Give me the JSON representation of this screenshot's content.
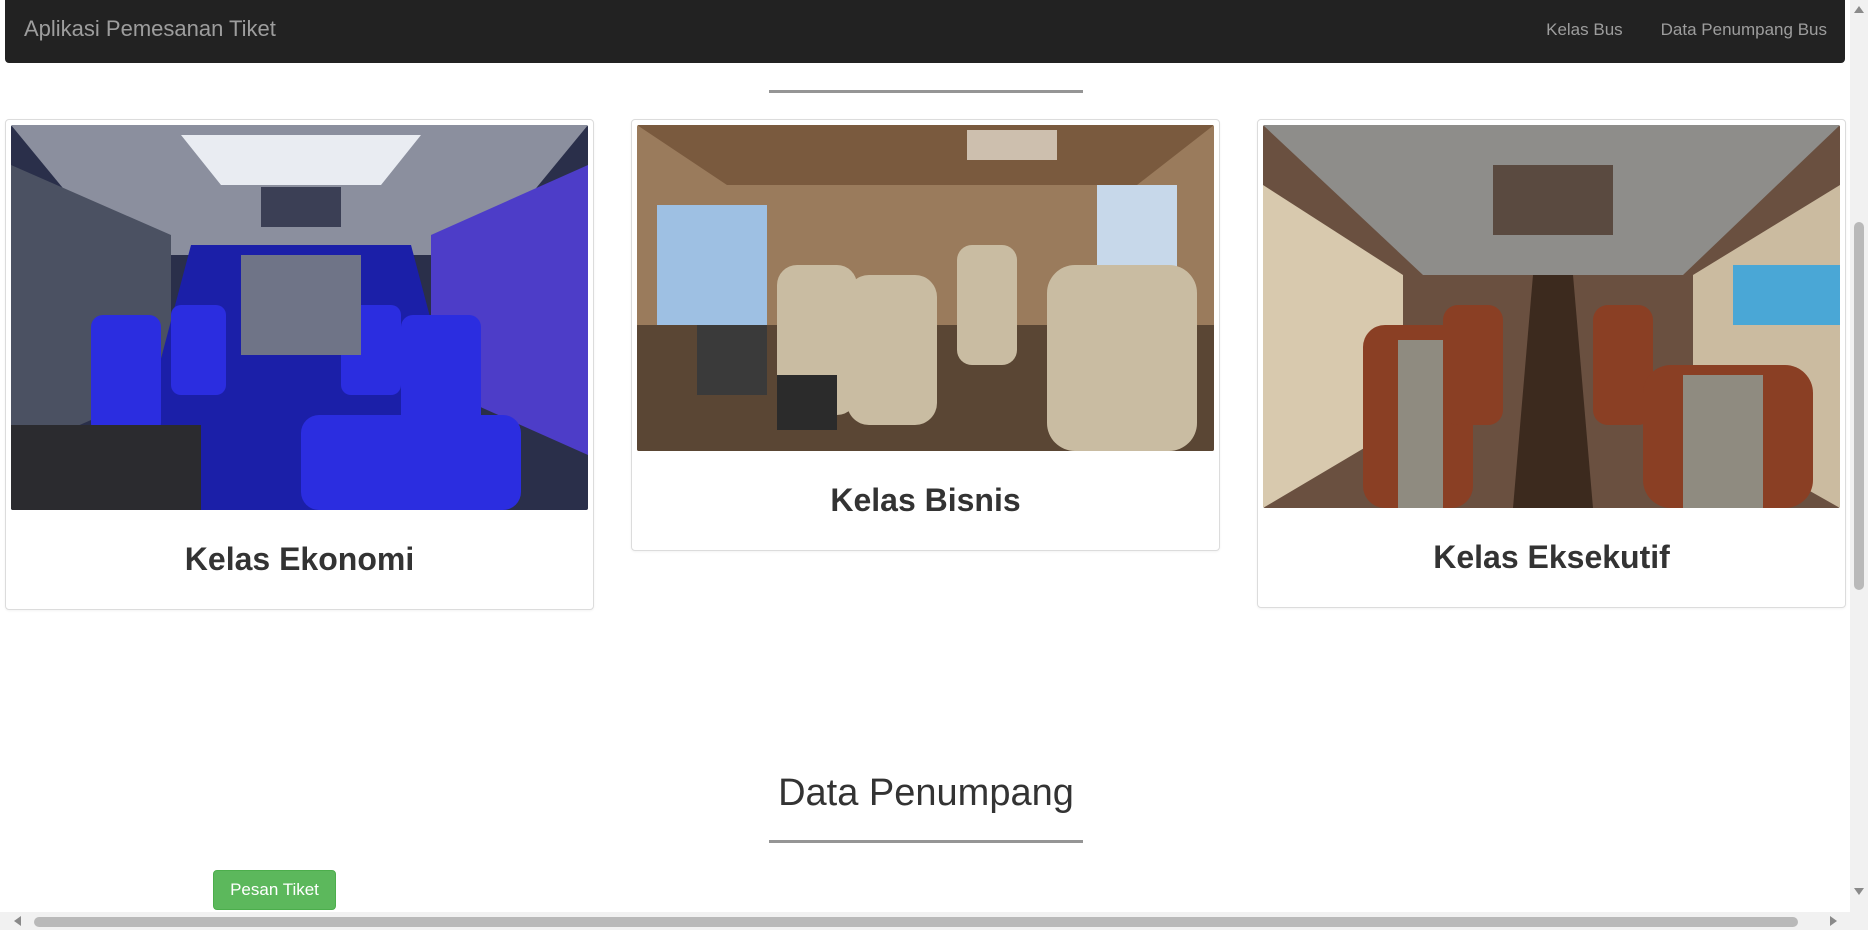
{
  "navbar": {
    "brand": "Aplikasi Pemesanan Tiket",
    "links": [
      "Kelas Bus",
      "Data Penumpang Bus"
    ]
  },
  "classes": [
    {
      "title": "Kelas Ekonomi",
      "image": "bus-interior-blue-seats"
    },
    {
      "title": "Kelas Bisnis",
      "image": "bus-interior-leather-seats"
    },
    {
      "title": "Kelas Eksekutif",
      "image": "bus-interior-brown-seats"
    }
  ],
  "penumpang": {
    "heading": "Data Penumpang",
    "button": "Pesan Tiket"
  },
  "colors": {
    "navbar": "#222222",
    "success": "#5cb85c"
  }
}
